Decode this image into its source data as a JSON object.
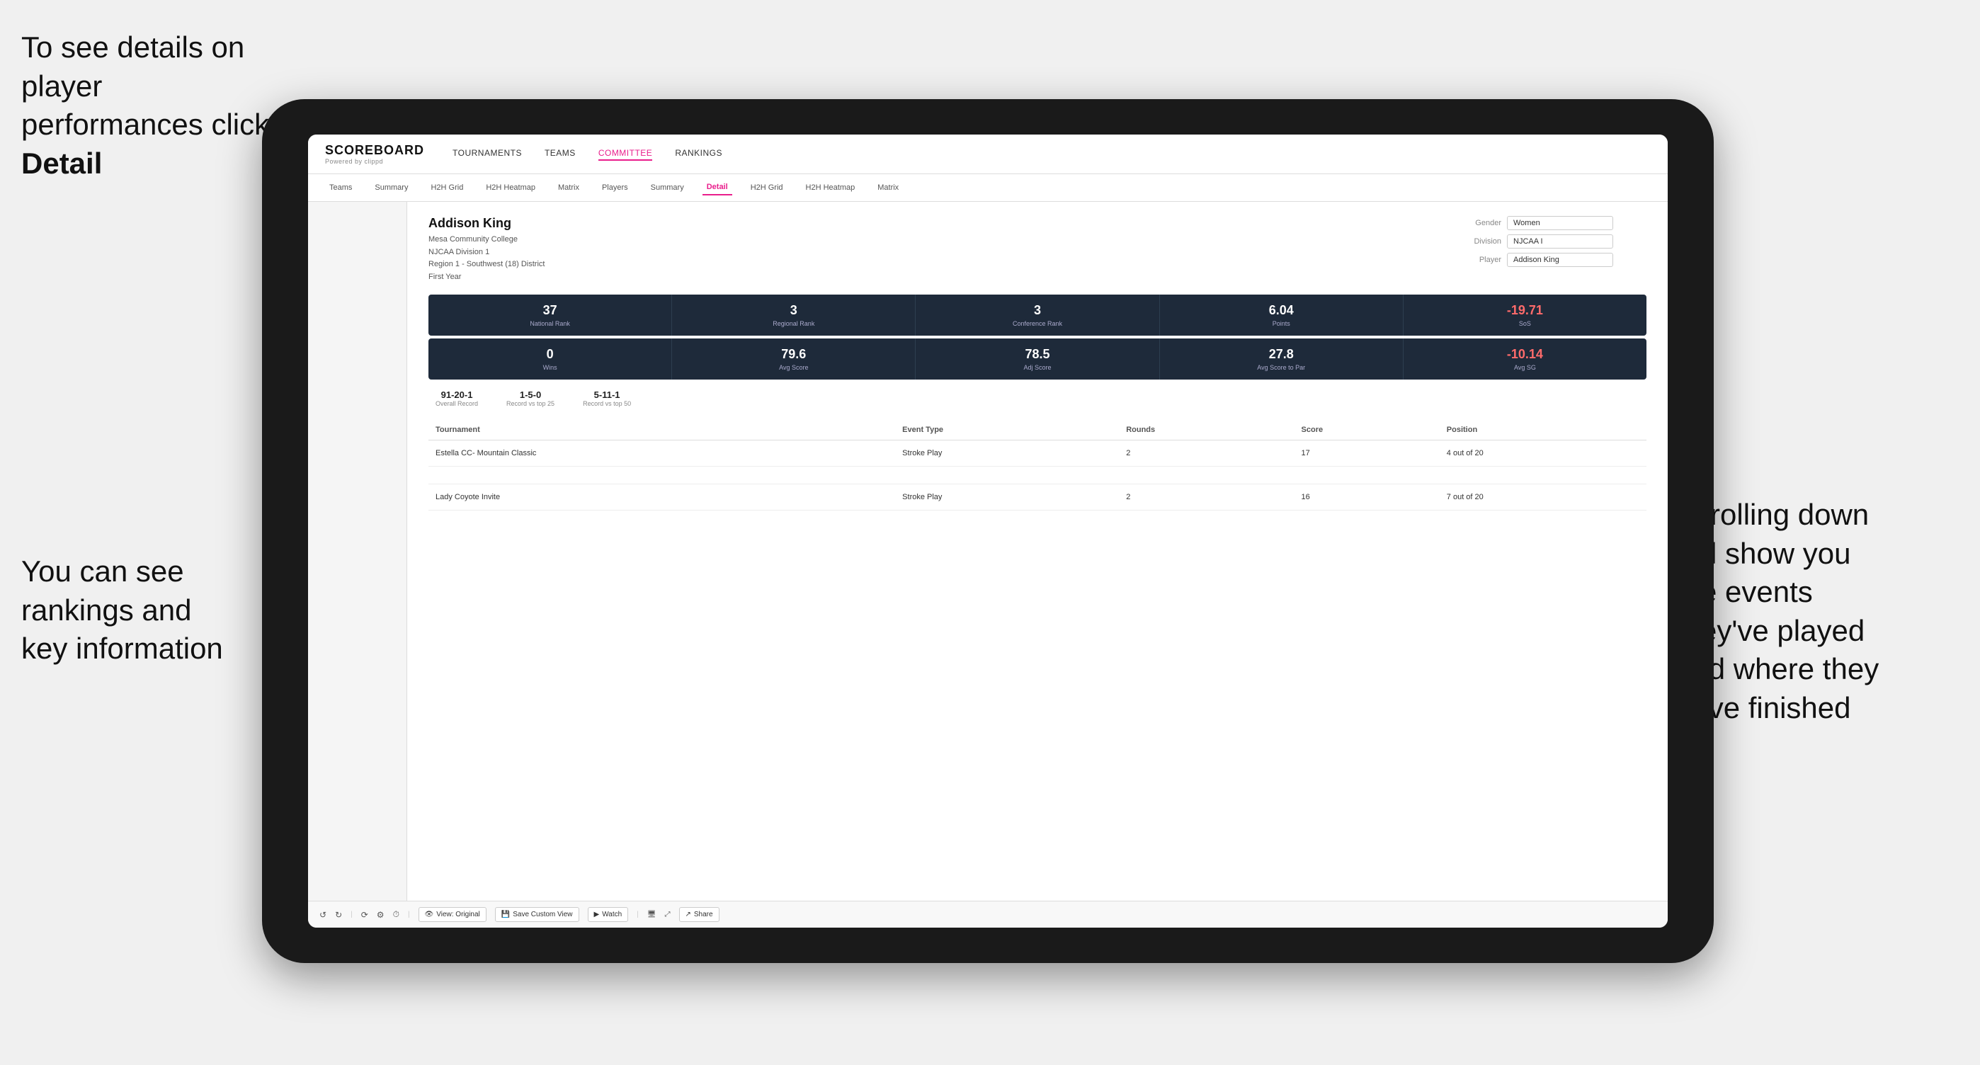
{
  "annotations": {
    "top_left": "To see details on player performances click ",
    "top_left_bold": "Detail",
    "bottom_left_line1": "You can see",
    "bottom_left_line2": "rankings and",
    "bottom_left_line3": "key information",
    "right_line1": "Scrolling down",
    "right_line2": "will show you",
    "right_line3": "the events",
    "right_line4": "they've played",
    "right_line5": "and where they",
    "right_line6": "have finished"
  },
  "nav": {
    "logo": "SCOREBOARD",
    "logo_sub": "Powered by clippd",
    "main_items": [
      "TOURNAMENTS",
      "TEAMS",
      "COMMITTEE",
      "RANKINGS"
    ],
    "active_main": "COMMITTEE",
    "sub_items": [
      "Teams",
      "Summary",
      "H2H Grid",
      "H2H Heatmap",
      "Matrix",
      "Players",
      "Summary",
      "Detail",
      "H2H Grid",
      "H2H Heatmap",
      "Matrix"
    ],
    "active_sub": "Detail"
  },
  "player": {
    "name": "Addison King",
    "school": "Mesa Community College",
    "division": "NJCAA Division 1",
    "region": "Region 1 - Southwest (18) District",
    "year": "First Year",
    "gender_label": "Gender",
    "gender_value": "Women",
    "division_label": "Division",
    "division_value": "NJCAA I",
    "player_label": "Player",
    "player_value": "Addison King"
  },
  "stats_row1": [
    {
      "value": "37",
      "label": "National Rank"
    },
    {
      "value": "3",
      "label": "Regional Rank"
    },
    {
      "value": "3",
      "label": "Conference Rank"
    },
    {
      "value": "6.04",
      "label": "Points"
    },
    {
      "value": "-19.71",
      "label": "SoS",
      "negative": true
    }
  ],
  "stats_row2": [
    {
      "value": "0",
      "label": "Wins"
    },
    {
      "value": "79.6",
      "label": "Avg Score"
    },
    {
      "value": "78.5",
      "label": "Adj Score"
    },
    {
      "value": "27.8",
      "label": "Avg Score to Par"
    },
    {
      "value": "-10.14",
      "label": "Avg SG",
      "negative": true
    }
  ],
  "records": [
    {
      "value": "91-20-1",
      "label": "Overall Record"
    },
    {
      "value": "1-5-0",
      "label": "Record vs top 25"
    },
    {
      "value": "5-11-1",
      "label": "Record vs top 50"
    }
  ],
  "table": {
    "headers": [
      "Tournament",
      "Event Type",
      "Rounds",
      "Score",
      "Position"
    ],
    "rows": [
      {
        "tournament": "Estella CC- Mountain Classic",
        "event_type": "Stroke Play",
        "rounds": "2",
        "score": "17",
        "position": "4 out of 20"
      },
      {
        "tournament": "",
        "event_type": "",
        "rounds": "",
        "score": "",
        "position": ""
      },
      {
        "tournament": "Lady Coyote Invite",
        "event_type": "Stroke Play",
        "rounds": "2",
        "score": "16",
        "position": "7 out of 20"
      }
    ]
  },
  "toolbar": {
    "view_original": "View: Original",
    "save_custom": "Save Custom View",
    "watch": "Watch",
    "share": "Share"
  }
}
